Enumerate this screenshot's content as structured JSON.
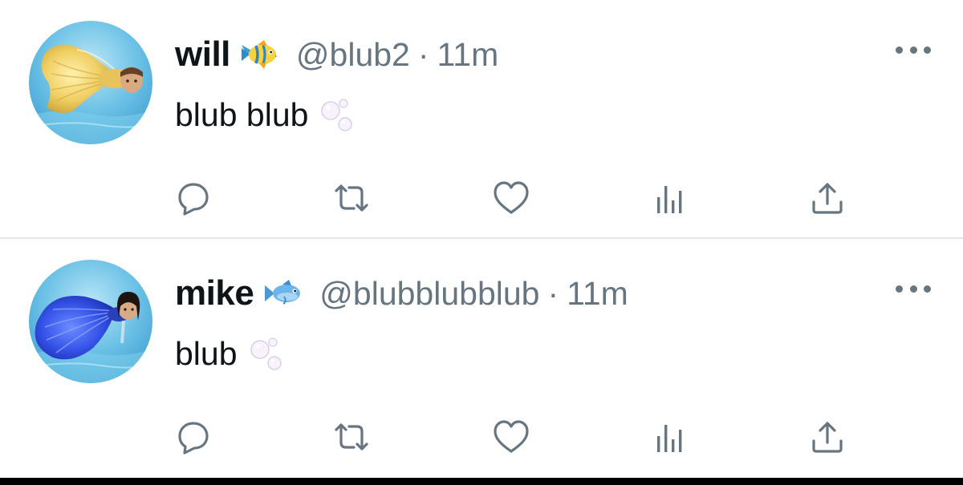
{
  "tweets": [
    {
      "display_name": "will",
      "name_emoji_icon": "tropical-fish-icon",
      "handle": "@blub2",
      "separator": "·",
      "time": "11m",
      "text": "blub blub",
      "text_emoji_icon": "bubbles-icon",
      "avatar": "golden-betta-fish-avatar",
      "actions": [
        "reply-icon",
        "retweet-icon",
        "like-icon",
        "analytics-icon",
        "share-icon"
      ]
    },
    {
      "display_name": "mike",
      "name_emoji_icon": "blue-fish-icon",
      "handle": "@blubblubblub",
      "separator": "·",
      "time": "11m",
      "text": "blub",
      "text_emoji_icon": "bubbles-icon",
      "avatar": "blue-betta-fish-avatar",
      "actions": [
        "reply-icon",
        "retweet-icon",
        "like-icon",
        "analytics-icon",
        "share-icon"
      ]
    }
  ],
  "colors": {
    "name_text": "#0f1419",
    "secondary_text": "#66757f",
    "icon_gray": "#66757f",
    "divider": "#e4e7ea",
    "avatar_water": "#5fb6e0"
  }
}
